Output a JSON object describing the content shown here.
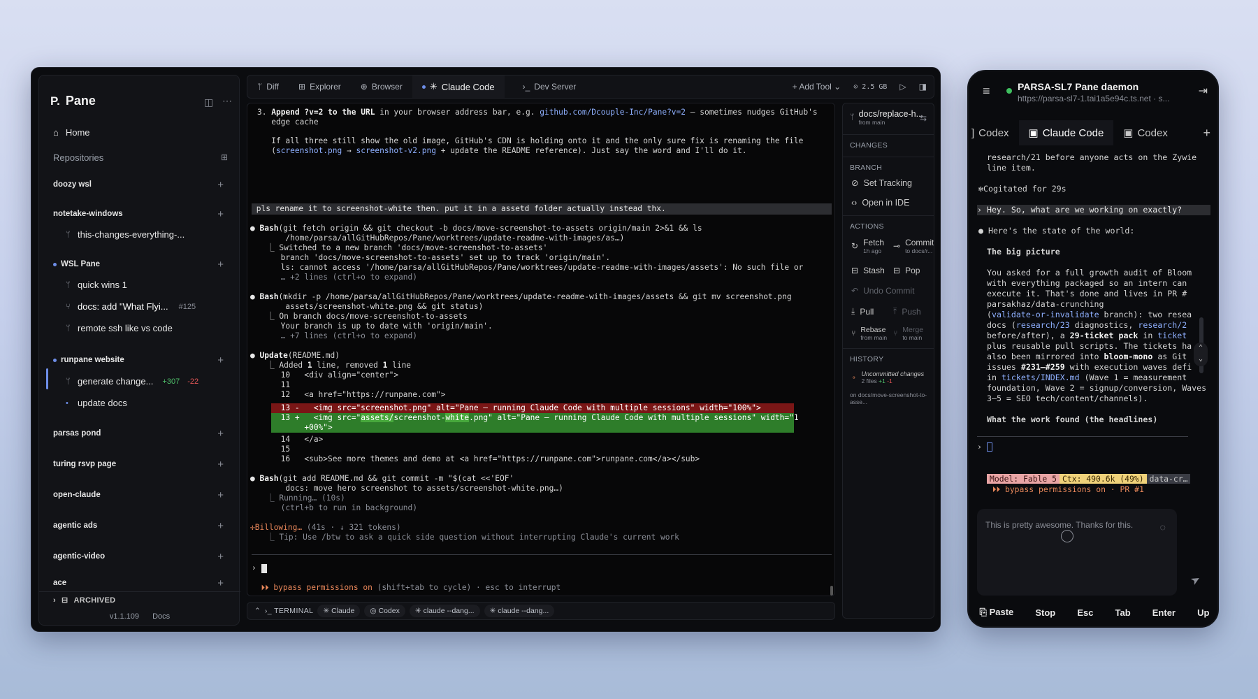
{
  "app": {
    "brand": "Pane",
    "home": "Home",
    "repositories_label": "Repositories",
    "repos": [
      {
        "name": "doozy wsl"
      },
      {
        "name": "notetake-windows",
        "branches": [
          {
            "name": "this-changes-everything-..."
          }
        ]
      },
      {
        "name": "WSL Pane",
        "branches": [
          {
            "name": "quick wins 1"
          },
          {
            "name": "docs: add \"What Flyi...",
            "meta": "#125"
          },
          {
            "name": "remote ssh like vs code"
          }
        ]
      },
      {
        "name": "runpane website",
        "branches": [
          {
            "name": "generate change...",
            "add": "+307",
            "del": "-22"
          },
          {
            "name": "update docs"
          }
        ]
      },
      {
        "name": "parsas pond"
      },
      {
        "name": "turing rsvp page"
      },
      {
        "name": "open-claude"
      },
      {
        "name": "agentic ads"
      },
      {
        "name": "agentic-video"
      },
      {
        "name": "ace"
      }
    ],
    "archived": "ARCHIVED",
    "version": "v1.1.109",
    "docs": "Docs"
  },
  "toolbar": {
    "tabs": [
      "Diff",
      "Explorer",
      "Browser",
      "Claude Code",
      "Dev Server"
    ],
    "add_tool": "+ Add Tool",
    "memory": "2.5 GB"
  },
  "terminal": {
    "l1_num": "3.",
    "l1_b": "Append",
    "l1_code": "?v=2",
    "l1_b2": "to the URL",
    "l1_t": " in your browser address bar, e.g. ",
    "l1_link": "github.com/Dcouple-Inc/Pane?v=2",
    "l1_t2": " — sometimes nudges GitHub's",
    "l2": "   edge cache",
    "l3": "   If all three still show the old image, GitHub's CDN is holding onto it and the only sure fix is renaming the file",
    "l4_a": "   (",
    "l4_f1": "screenshot.png",
    "l4_arrow": " → ",
    "l4_f2": "screenshot-v2.png",
    "l4_b": " + update the README reference). Just say the word and I'll do it.",
    "user_msg": " pls rename it to screenshot-white then. put it in a assetd folder actually instead thx.",
    "bash1_tool": "Bash",
    "bash1_cmd": "(git fetch origin && git checkout -b docs/move-screenshot-to-assets origin/main 2>&1 && ls",
    "bash1_cmd2": "      /home/parsa/allGitHubRepos/Pane/worktrees/update-readme-with-images/as…)",
    "bash1_o1": "  ⎿ Switched to a new branch 'docs/move-screenshot-to-assets'",
    "bash1_o2": "     branch 'docs/move-screenshot-to-assets' set up to track 'origin/main'.",
    "bash1_o3": "     ls: cannot access '/home/parsa/allGitHubRepos/Pane/worktrees/update-readme-with-images/assets': No such file or",
    "bash1_o4": "     … +2 lines (ctrl+o to expand)",
    "bash2_tool": "Bash",
    "bash2_cmd": "(mkdir -p /home/parsa/allGitHubRepos/Pane/worktrees/update-readme-with-images/assets && git mv screenshot.png",
    "bash2_cmd2": "      assets/screenshot-white.png && git status)",
    "bash2_o1": "  ⎿ On branch docs/move-screenshot-to-assets",
    "bash2_o2": "     Your branch is up to date with 'origin/main'.",
    "bash2_o3": "     … +7 lines (ctrl+o to expand)",
    "upd_tool": "Update",
    "upd_file": "(README.md)",
    "upd_summary_a": "  ⎿ Added ",
    "upd_n1": "1",
    "upd_summary_b": " line, removed ",
    "upd_n2": "1",
    "upd_summary_c": " line",
    "d10": "     10   <div align=\"center\">",
    "d11": "     11",
    "d12": "     12   <a href=\"https://runpane.com\">",
    "d13del": "     13 -   <img src=\"screenshot.png\" alt=\"Pane — running Claude Code with multiple sessions\" width=\"100%\">",
    "d13add_a": "     13 +   <img src=\"",
    "d13add_hl": "assets/",
    "d13add_b": "screenshot-",
    "d13add_hl2": "white",
    "d13add_c": ".png\" alt=\"Pane — running Claude Code with multiple sessions\" width=\"1",
    "d13add2": "          +00%\">",
    "d14": "     14   </a>",
    "d15": "     15",
    "d16": "     16   <sub>See more themes and demo at <a href=\"https://runpane.com\">runpane.com</a></sub>",
    "bash3_tool": "Bash",
    "bash3_cmd": "(git add README.md && git commit -m \"$(cat <<'EOF'",
    "bash3_cmd2": "      docs: move hero screenshot to assets/screenshot-white.png…)",
    "bash3_o1": "  ⎿ Running… (10s)",
    "bash3_o2": "     (ctrl+b to run in background)",
    "billow": "Billowing…",
    "billow_meta": " (41s · ↓ 321 tokens)",
    "tip": "  ⎿ Tip: Use /btw to ask a quick side question without interrupting Claude's current work",
    "prompt": "›",
    "bypass_a": "  ⏵⏵ bypass permissions on",
    "bypass_b": " (shift+tab to cycle) · esc to interrupt"
  },
  "gitpanel": {
    "branch": "docs/replace-h...",
    "from": "from main",
    "changes": "CHANGES",
    "branch_h": "BRANCH",
    "set_tracking": "Set Tracking",
    "open_ide": "Open in IDE",
    "actions": "ACTIONS",
    "fetch": "Fetch",
    "fetch_sub": "1h ago",
    "commit": "Commit",
    "commit_sub": "to docs/r...",
    "stash": "Stash",
    "pop": "Pop",
    "undo": "Undo Commit",
    "pull": "Pull",
    "push": "Push",
    "rebase": "Rebase",
    "rebase_sub": "from main",
    "merge": "Merge",
    "merge_sub": "to main",
    "history": "HISTORY",
    "uncommitted": "Uncommitted changes",
    "files": "2 files",
    "files_add": "+1",
    "files_del": "-1",
    "on_branch": "on docs/move-screenshot-to-asse..."
  },
  "bottombar": {
    "terminal": "TERMINAL",
    "tabs": [
      "Claude",
      "Codex",
      "claude --dang...",
      "claude --dang..."
    ]
  },
  "mobile": {
    "title": "PARSA-SL7 Pane daemon",
    "url": "https://parsa-sl7-1.tai1a5e94c.ts.net · s...",
    "tabs": [
      "Codex",
      "Claude Code",
      "Codex"
    ],
    "m1": "research/21 before anyone acts on the Zywie",
    "m2": "line item.",
    "m3": "✻Cogitated for 29s",
    "user_msg": " Hey. So, what are we working on exactly?",
    "m4": "● Here's the state of the world:",
    "m5": "The big picture",
    "m6": "You asked for a full growth audit of Bloom",
    "m7": "with everything packaged so an intern can",
    "m8": "execute it. That's done and lives in PR #",
    "m9": "parsakhaz/data-crunching",
    "m10a": "(",
    "m10b": "validate-or-invalidate",
    "m10c": " branch): two resea",
    "m11a": "docs (",
    "m11b": "research/23",
    "m11c": " diagnostics, ",
    "m11d": "research/2",
    "m12a": "before/after), a ",
    "m12b": "29-ticket pack",
    "m12c": " in ",
    "m12d": "ticket",
    "m13": "plus reusable pull scripts. The tickets ha",
    "m14a": "also been mirrored into ",
    "m14b": "bloom-mono",
    "m14c": " as Git",
    "m15a": "issues ",
    "m15b": "#231–#259",
    "m15c": " with execution waves defi",
    "m16a": "in ",
    "m16b": "tickets/INDEX.md",
    "m16c": " (Wave 1 = measurement",
    "m17": "foundation, Wave 2 = signup/conversion, Waves",
    "m18": "3–5 = SEO tech/content/channels).",
    "m19": "What the work found (the headlines)",
    "prompt": "›",
    "model": "Model: Fable 5",
    "ctx": "Ctx: 490.6k (49%)",
    "branch": "data-cr…",
    "bypass": "  ⏵⏵ bypass permissions on · PR #1",
    "input_text": "This is pretty awesome. Thanks for this.",
    "keys": [
      "Paste",
      "Stop",
      "Esc",
      "Tab",
      "Enter",
      "Up"
    ]
  }
}
